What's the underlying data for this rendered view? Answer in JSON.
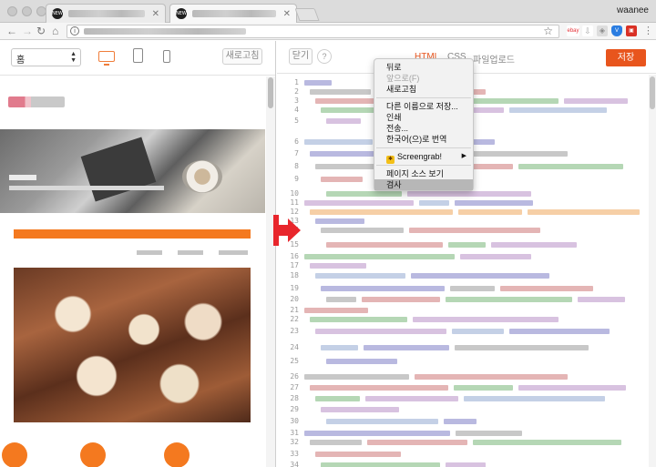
{
  "browser": {
    "tabs": [
      {
        "favicon": "NEW",
        "active": false
      },
      {
        "favicon": "NEW",
        "active": true
      }
    ],
    "user_name": "waanee",
    "extensions": [
      "ebay-icon",
      "download-icon",
      "shield-icon",
      "extension-icon",
      "screengrab-icon",
      "screencast-icon"
    ]
  },
  "preview": {
    "device_select": "홈",
    "refresh_label": "새로고침"
  },
  "editor": {
    "close_label": "닫기",
    "help_label": "?",
    "tabs": [
      "HTML",
      "CSS",
      "파일업로드"
    ],
    "active_tab": "HTML",
    "save_label": "저장",
    "line_numbers": [
      "1",
      "2",
      "3",
      "4",
      "5",
      "6",
      "7",
      "8",
      "9",
      "10",
      "11",
      "12",
      "13",
      "14",
      "15",
      "16",
      "17",
      "18",
      "19",
      "20",
      "21",
      "22",
      "23",
      "24",
      "25",
      "26",
      "27",
      "28",
      "29",
      "30",
      "31",
      "32",
      "33",
      "34"
    ]
  },
  "context_menu": {
    "items": [
      {
        "label": "뒤로",
        "disabled": false
      },
      {
        "label": "앞으로(F)",
        "disabled": true
      },
      {
        "label": "새로고침",
        "disabled": false
      },
      {
        "label": "다른 이름으로 저장...",
        "disabled": false
      },
      {
        "label": "인쇄",
        "disabled": false
      },
      {
        "label": "전송...",
        "disabled": false
      },
      {
        "label": "한국어(으)로 번역",
        "disabled": false
      },
      {
        "label": "Screengrab!",
        "disabled": false
      },
      {
        "label": "페이지 소스 보기",
        "disabled": false
      },
      {
        "label": "검사",
        "disabled": false,
        "highlighted": true
      }
    ]
  },
  "colors": {
    "accent": "#e8551d",
    "preview_orange": "#f4791f",
    "arrow_red": "#e8262c"
  }
}
